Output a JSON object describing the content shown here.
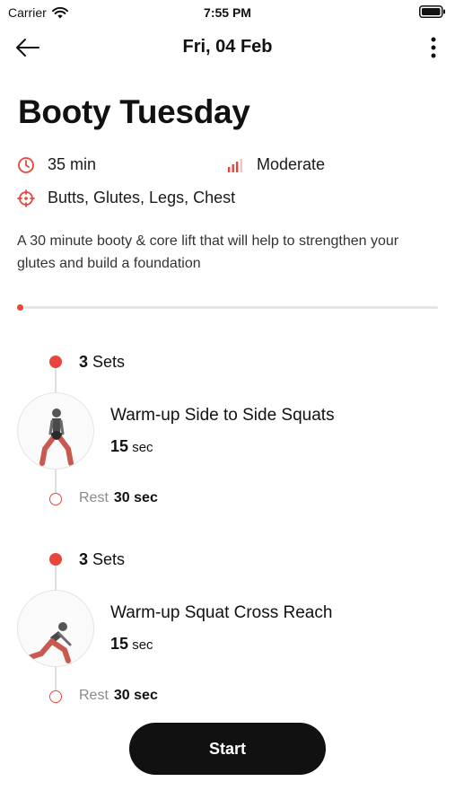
{
  "status_bar": {
    "carrier": "Carrier",
    "time": "7:55 PM"
  },
  "nav": {
    "date_title": "Fri, 04 Feb"
  },
  "workout": {
    "title": "Booty Tuesday",
    "duration": "35 min",
    "difficulty": "Moderate",
    "target_areas": "Butts, Glutes, Legs, Chest",
    "description": "A 30 minute booty & core lift that will help to strengthen your glutes and build a foundation",
    "progress_fraction": 0.0
  },
  "blocks": [
    {
      "sets_count": "3",
      "sets_label": "Sets",
      "exercise_name": "Warm-up Side to Side Squats",
      "duration_value": "15",
      "duration_unit": "sec",
      "rest_label": "Rest",
      "rest_value": "30 sec"
    },
    {
      "sets_count": "3",
      "sets_label": "Sets",
      "exercise_name": "Warm-up Squat Cross Reach",
      "duration_value": "15",
      "duration_unit": "sec",
      "rest_label": "Rest",
      "rest_value": "30 sec"
    }
  ],
  "actions": {
    "start_label": "Start"
  },
  "colors": {
    "accent": "#e8453c",
    "button_bg": "#111111"
  },
  "icons": {
    "back": "arrow-left-icon",
    "more": "more-vertical-icon",
    "duration": "clock-icon",
    "difficulty": "signal-bars-icon",
    "targets": "crosshair-icon"
  }
}
